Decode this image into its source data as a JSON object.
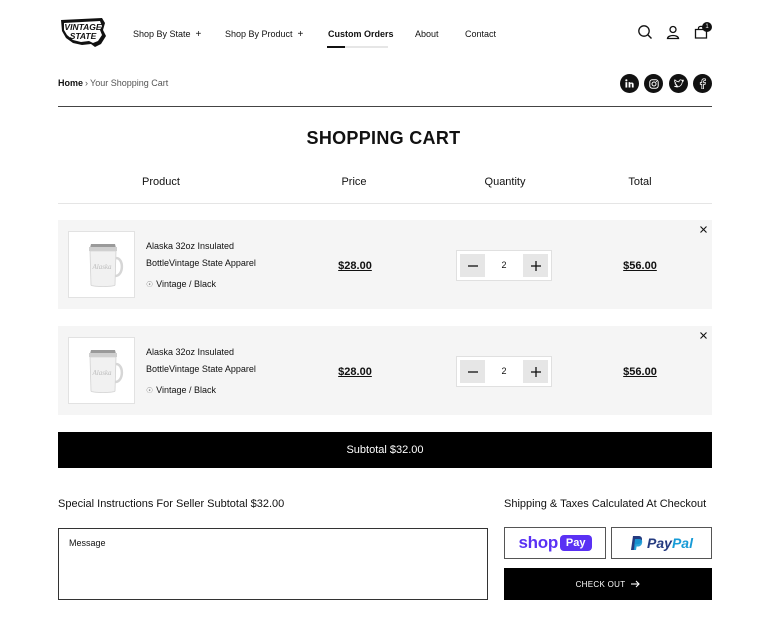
{
  "brand": {
    "logo_line1": "VINTAGE",
    "logo_line2": "STATE"
  },
  "nav": {
    "items": [
      {
        "label": "Shop By State",
        "has_plus": true
      },
      {
        "label": "Shop By Product",
        "has_plus": true
      },
      {
        "label": "Custom Orders",
        "has_plus": false
      },
      {
        "label": "About",
        "has_plus": false
      },
      {
        "label": "Contact",
        "has_plus": false
      }
    ],
    "plus_symbol": "+",
    "cart_count": "1"
  },
  "breadcrumb": {
    "home": "Home",
    "separator": "›",
    "current": "Your Shopping Cart"
  },
  "social_icons": [
    "linkedin-icon",
    "instagram-icon",
    "twitter-icon",
    "facebook-icon"
  ],
  "page_title": "SHOPPING CART",
  "columns": {
    "product": "Product",
    "price": "Price",
    "quantity": "Quantity",
    "total": "Total"
  },
  "cart": {
    "items": [
      {
        "name": "Alaska 32oz Insulated BottleVintage State Apparel",
        "variant": "Vintage / Black",
        "price": "$28.00",
        "quantity": "2",
        "total": "$56.00"
      },
      {
        "name": "Alaska 32oz Insulated BottleVintage State Apparel",
        "variant": "Vintage / Black",
        "price": "$28.00",
        "quantity": "2",
        "total": "$56.00"
      }
    ],
    "subtotal": "Subtotal $32.00"
  },
  "instructions": {
    "label": "Special Instructions For Seller Subtotal $32.00",
    "placeholder": "Message"
  },
  "shipping_note": "Shipping & Taxes Calculated At Checkout",
  "payments": {
    "shop_text": "shop",
    "shop_pay_text": "Pay",
    "paypal_pay": "Pay",
    "paypal_pal": "Pal"
  },
  "checkout_label": "CHECK OUT",
  "colors": {
    "shop_pay": "#5a31f4",
    "paypal_dark": "#253b80",
    "paypal_light": "#179bd7",
    "item_bg": "#f5f5f5"
  }
}
